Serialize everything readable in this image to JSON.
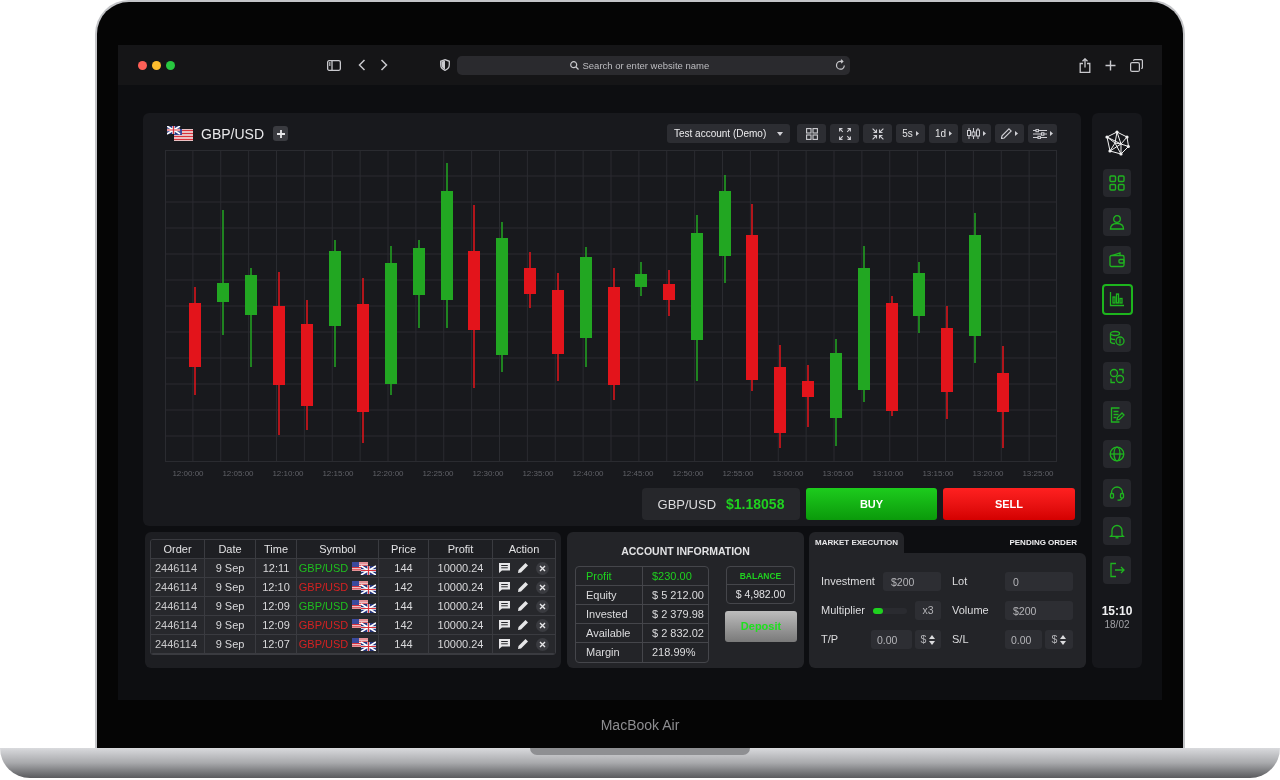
{
  "browser": {
    "address_bar": {
      "placeholder": "Search or enter website name"
    }
  },
  "chart_panel": {
    "symbol": "GBP/USD",
    "account_select": "Test account (Demo)",
    "timeframes": [
      "5s",
      "1d"
    ],
    "x_labels": [
      "12:00:00",
      "12:05:00",
      "12:10:00",
      "12:15:00",
      "12:20:00",
      "12:25:00",
      "12:30:00",
      "12:35:00",
      "12:40:00",
      "12:45:00",
      "12:50:00",
      "12:55:00",
      "13:00:00",
      "13:05:00",
      "13:10:00",
      "13:15:00",
      "13:20:00",
      "13:25:00"
    ],
    "quote": {
      "symbol": "GBP/USD",
      "price": "$1.18058"
    },
    "trade_buttons": [
      {
        "kind": "buy",
        "label": "BUY"
      },
      {
        "kind": "sell",
        "label": "SELL"
      }
    ]
  },
  "orders": {
    "columns": [
      "Order",
      "Date",
      "Time",
      "Symbol",
      "Price",
      "Profit",
      "Action"
    ],
    "rows": [
      {
        "order": "2446114",
        "date": "9 Sep",
        "time": "12:11",
        "symbol": "GBP/USD",
        "color": "#1fbf1f",
        "price": "144",
        "profit": "10000.24"
      },
      {
        "order": "2446114",
        "date": "9 Sep",
        "time": "12:10",
        "symbol": "GBP/USD",
        "color": "#d42222",
        "price": "142",
        "profit": "10000.24"
      },
      {
        "order": "2446114",
        "date": "9 Sep",
        "time": "12:09",
        "symbol": "GBP/USD",
        "color": "#1fbf1f",
        "price": "144",
        "profit": "10000.24"
      },
      {
        "order": "2446114",
        "date": "9 Sep",
        "time": "12:09",
        "symbol": "GBP/USD",
        "color": "#d42222",
        "price": "142",
        "profit": "10000.24"
      },
      {
        "order": "2446114",
        "date": "9 Sep",
        "time": "12:07",
        "symbol": "GBP/USD",
        "color": "#d42222",
        "price": "144",
        "profit": "10000.24"
      }
    ]
  },
  "account_info": {
    "title": "ACCOUNT INFORMATION",
    "rows": [
      {
        "label": "Profit",
        "value": "$230.00",
        "highlighted": true
      },
      {
        "label": "Equity",
        "value": "$ 5 212.00",
        "highlighted": false
      },
      {
        "label": "Invested",
        "value": "$ 2 379.98",
        "highlighted": false
      },
      {
        "label": "Available",
        "value": "$ 2 832.02",
        "highlighted": false
      },
      {
        "label": "Margin",
        "value": "218.99%",
        "highlighted": false
      }
    ],
    "balance": {
      "label": "BALANCE",
      "value": "$ 4,982.00"
    },
    "deposit_button": "Deposit"
  },
  "order_form": {
    "tabs": [
      {
        "label": "MARKET EXECUTION",
        "selected": true
      },
      {
        "label": "PENDING ORDER",
        "selected": false
      }
    ],
    "fields": [
      {
        "kind": "input",
        "label": "Investment",
        "value": "$200"
      },
      {
        "kind": "input",
        "label": "Lot",
        "value": "0"
      },
      {
        "kind": "slider",
        "label": "Multiplier",
        "level": 0.3,
        "reading": "x3"
      },
      {
        "kind": "input",
        "label": "Volume",
        "value": "$200"
      },
      {
        "kind": "price",
        "label": "T/P",
        "value": "0.00",
        "unit": "$"
      },
      {
        "kind": "price",
        "label": "S/L",
        "value": "0.00",
        "unit": "$"
      }
    ]
  },
  "sidebar": {
    "items": [
      {
        "selected": false
      },
      {
        "selected": false
      },
      {
        "selected": false
      },
      {
        "selected": true
      },
      {
        "selected": false
      },
      {
        "selected": false
      },
      {
        "selected": false
      },
      {
        "selected": false
      },
      {
        "selected": false
      },
      {
        "selected": false
      },
      {
        "selected": false
      }
    ],
    "time": "15:10",
    "date": "18/02"
  },
  "device": {
    "label": "MacBook Air"
  }
}
